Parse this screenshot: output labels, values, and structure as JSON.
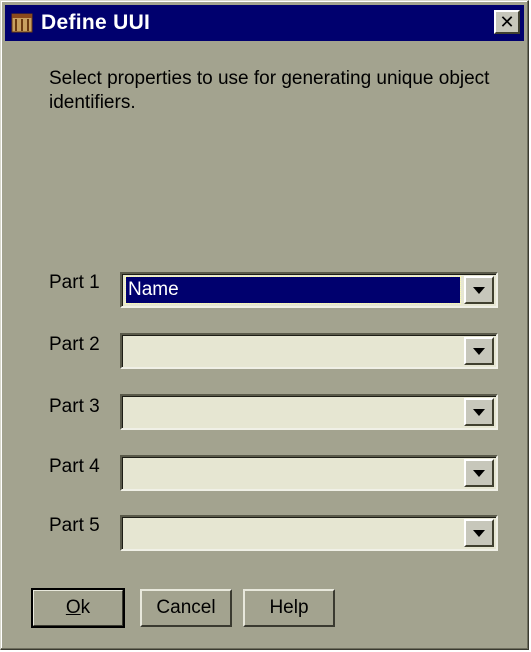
{
  "window": {
    "title": "Define UUI",
    "close_glyph": "✕",
    "icon": "app-icon"
  },
  "instructions": "Select properties to use for generating unique object identifiers.",
  "parts": [
    {
      "label": "Part 1",
      "value": "Name",
      "selected": true
    },
    {
      "label": "Part 2",
      "value": ""
    },
    {
      "label": "Part 3",
      "value": ""
    },
    {
      "label": "Part 4",
      "value": ""
    },
    {
      "label": "Part 5",
      "value": ""
    }
  ],
  "buttons": {
    "ok_mnemonic": "O",
    "ok_rest": "k",
    "cancel": "Cancel",
    "help": "Help"
  },
  "colors": {
    "dialog_bg": "#a3a38f",
    "title_bg": "#00006e",
    "field_bg": "#e6e6d2",
    "selection_bg": "#00006e"
  }
}
